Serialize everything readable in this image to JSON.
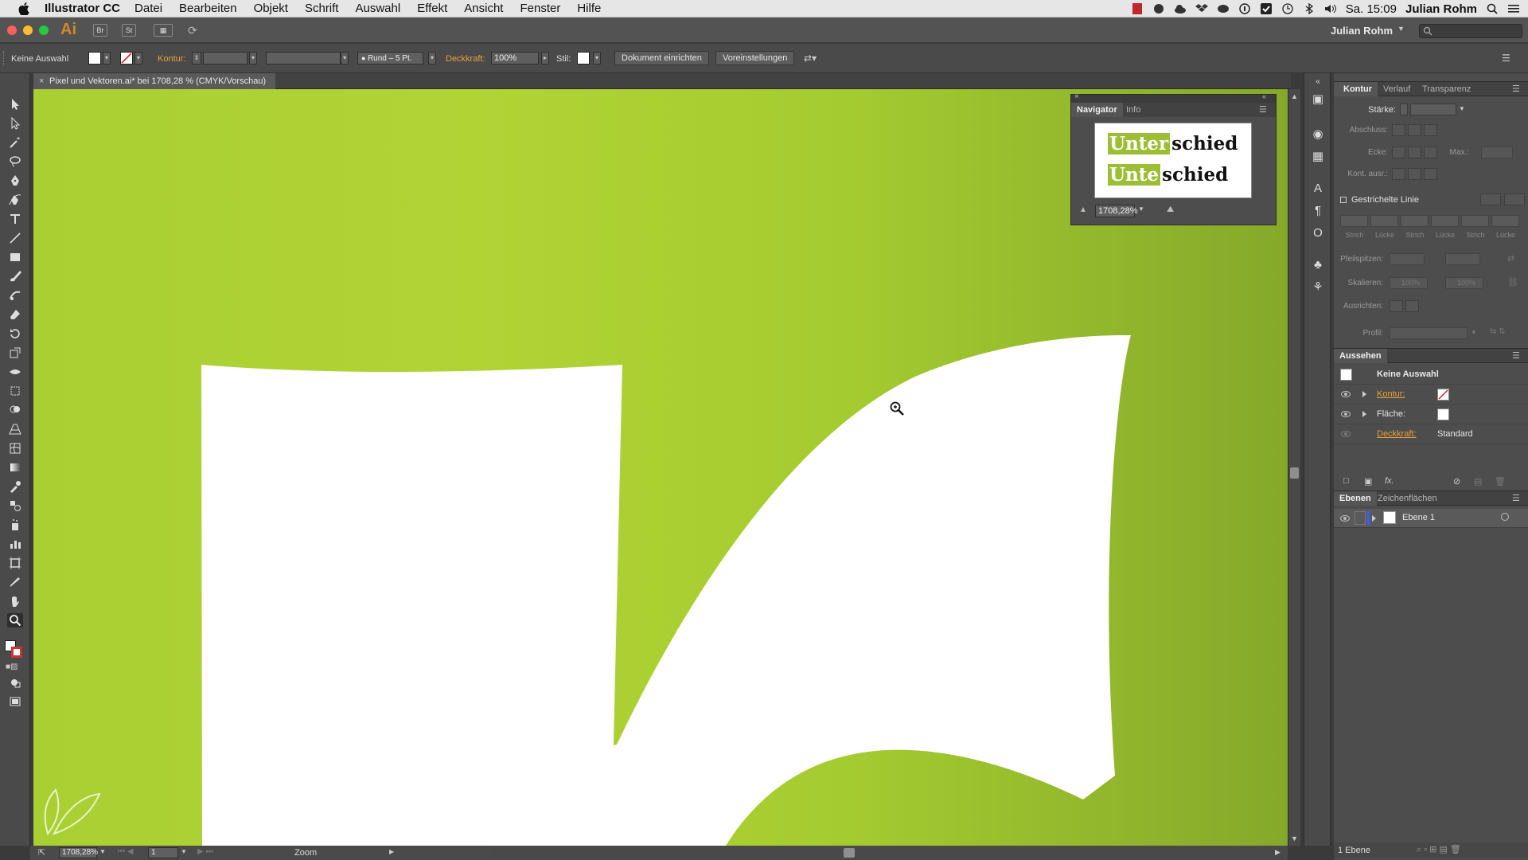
{
  "menubar": {
    "app_name": "Illustrator CC",
    "items": [
      "Datei",
      "Bearbeiten",
      "Objekt",
      "Schrift",
      "Auswahl",
      "Effekt",
      "Ansicht",
      "Fenster",
      "Hilfe"
    ],
    "clock": "Sa. 15:09",
    "user": "Julian Rohm",
    "status_icons": [
      "adobe-icon",
      "evernote-icon",
      "cloud-icon",
      "dropbox-icon",
      "drive-icon",
      "info-icon",
      "check-icon",
      "time-machine-icon",
      "bluetooth-icon",
      "volume-icon",
      "spotlight-icon",
      "list-icon"
    ]
  },
  "appbar": {
    "logo": "Ai",
    "bridge_label": "Br",
    "stock_label": "St",
    "user_label": "Julian Rohm"
  },
  "controlbar": {
    "selection_label": "Keine Auswahl",
    "kontur_label": "Kontur:",
    "brush_label": "Rund – 5 Pt.",
    "deckkraft_label": "Deckkraft:",
    "deckkraft_value": "100%",
    "stil_label": "Stil:",
    "dokument_button": "Dokument einrichten",
    "voreinstellungen_button": "Voreinstellungen"
  },
  "document_tab": {
    "title": "Pixel und Vektoren.ai* bei 1708,28 % (CMYK/Vorschau)"
  },
  "navigator": {
    "tab_active": "Navigator",
    "tab_inactive": "Info",
    "words": [
      {
        "highlight": "Unter",
        "rest": "schied"
      },
      {
        "highlight": "Unte",
        "rest": "schied"
      }
    ],
    "zoom": "1708,28%"
  },
  "kontur_panel": {
    "tabs": [
      "Kontur",
      "Verlauf",
      "Transparenz"
    ],
    "staerke": "Stärke:",
    "abschluss": "Abschluss:",
    "ecke": "Ecke:",
    "max": "Max.:",
    "kont_ausr": "Kont. ausr.:",
    "gestrichelte_linie": "Gestrichelte Linie",
    "dash_labels": [
      "Strich",
      "Lücke",
      "Strich",
      "Lücke",
      "Strich",
      "Lücke"
    ],
    "pfeilspitzen": "Pfeilspitzen:",
    "skalieren": "Skalieren:",
    "skalieren_value1": "100%",
    "skalieren_value2": "100%",
    "ausrichten": "Ausrichten:",
    "profil": "Profil:"
  },
  "aussehen_panel": {
    "title": "Aussehen",
    "selection": "Keine Auswahl",
    "kontur": "Kontur:",
    "flaeche": "Fläche:",
    "deckkraft": "Deckkraft:",
    "deckkraft_value": "Standard"
  },
  "ebenen_panel": {
    "tabs": [
      "Ebenen",
      "Zeichenflächen"
    ],
    "layer_name": "Ebene 1",
    "footer": "1 Ebene"
  },
  "statusbar": {
    "zoom": "1708,28%",
    "artboard": "1",
    "tool": "Zoom"
  },
  "colors": {
    "canvas_green": "#a9cf33",
    "accent_orange": "#e9a13a",
    "highlight_green": "#9cbe34"
  }
}
